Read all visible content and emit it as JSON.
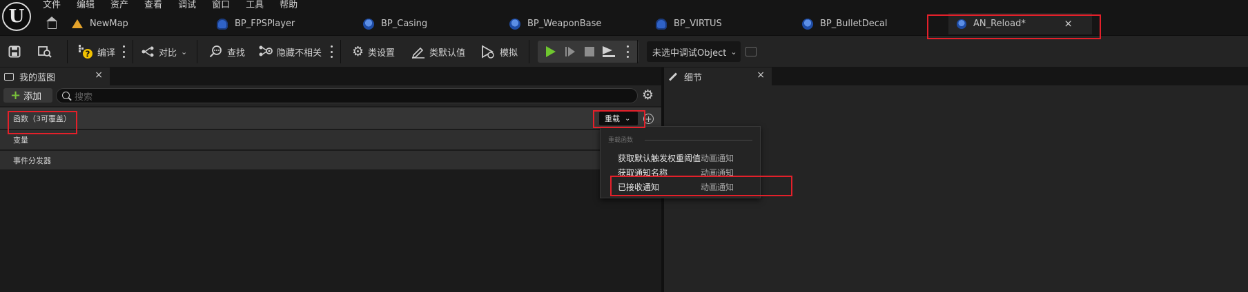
{
  "app": {
    "logo_letter": "U"
  },
  "menu": [
    "文件",
    "编辑",
    "资产",
    "查看",
    "调试",
    "窗口",
    "工具",
    "帮助"
  ],
  "tabs": [
    {
      "label": "",
      "icon": "home-icon"
    },
    {
      "label": "NewMap",
      "icon": "map-icon"
    },
    {
      "label": "BP_FPSPlayer",
      "icon": "character-blueprint-icon"
    },
    {
      "label": "BP_Casing",
      "icon": "blueprint-icon"
    },
    {
      "label": "BP_WeaponBase",
      "icon": "blueprint-icon"
    },
    {
      "label": "BP_VIRTUS",
      "icon": "character-blueprint-icon"
    },
    {
      "label": "BP_BulletDecal",
      "icon": "blueprint-icon"
    },
    {
      "label": "AN_Reload*",
      "icon": "anim-notify-icon",
      "close": "×",
      "active": true
    }
  ],
  "toolbar": {
    "compile": "编译",
    "diff": "对比",
    "find": "查找",
    "hide_unrelated": "隐藏不相关",
    "class_settings": "类设置",
    "class_defaults": "类默认值",
    "simulate": "模拟",
    "debug_object": "未选中调试Object"
  },
  "my_blueprint": {
    "tab_title": "我的蓝图",
    "close": "×",
    "add_label": "添加",
    "search_placeholder": "搜索",
    "sections": {
      "functions": "函数（3可覆盖）",
      "variables": "变量",
      "event_dispatchers": "事件分发器"
    },
    "override_label": "重载"
  },
  "details": {
    "tab_title": "细节",
    "close": "×"
  },
  "override_menu": {
    "header": "重载函数",
    "items": [
      {
        "name": "获取默认触发权重阈值",
        "category": "动画通知"
      },
      {
        "name": "获取通知名称",
        "category": "动画通知"
      },
      {
        "name": "已接收通知",
        "category": "动画通知"
      }
    ]
  },
  "colors": {
    "highlight": "#e4202a",
    "play": "#6fc72f",
    "add_plus": "#79c23a"
  }
}
